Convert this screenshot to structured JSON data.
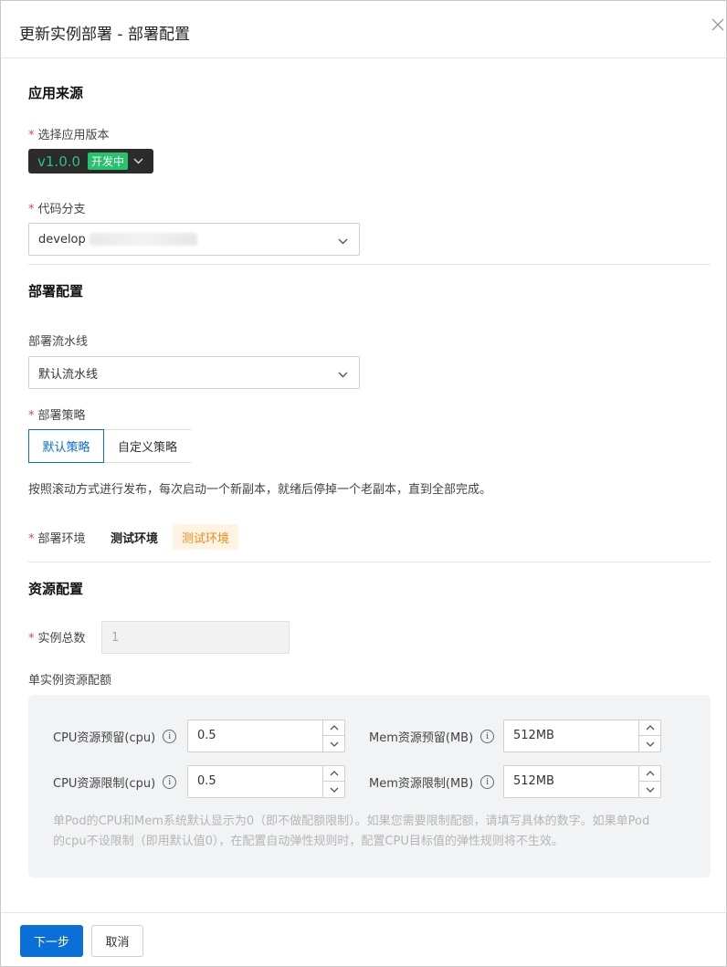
{
  "dialog": {
    "title": "更新实例部署 - 部署配置",
    "close_icon": "close-icon"
  },
  "app_source": {
    "section_title": "应用来源",
    "version_label": "选择应用版本",
    "version_value": "v1.0.0",
    "version_tag": "开发中",
    "branch_label": "代码分支",
    "branch_value": "develop"
  },
  "deploy": {
    "section_title": "部署配置",
    "pipeline_label": "部署流水线",
    "pipeline_value": "默认流水线",
    "strategy_label": "部署策略",
    "strategy_options": [
      "默认策略",
      "自定义策略"
    ],
    "strategy_selected": "默认策略",
    "strategy_desc": "按照滚动方式进行发布，每次启动一个新副本，就绪后停掉一个老副本，直到全部完成。",
    "env_label": "部署环境",
    "env_name": "测试环境",
    "env_badge": "测试环境"
  },
  "resources": {
    "section_title": "资源配置",
    "instances_label": "实例总数",
    "instances_value": "1",
    "per_instance_label": "单实例资源配额",
    "cpu_request_label": "CPU资源预留(cpu)",
    "cpu_request_value": "0.5",
    "mem_request_label": "Mem资源预留(MB)",
    "mem_request_value": "512MB",
    "cpu_limit_label": "CPU资源限制(cpu)",
    "cpu_limit_value": "0.5",
    "mem_limit_label": "Mem资源限制(MB)",
    "mem_limit_value": "512MB",
    "info_glyph": "i",
    "hint_line1": "单Pod的CPU和Mem系统默认显示为0（即不做配额限制）。如果您需要限制配额，请填写具体的数字。如果单Pod",
    "hint_line2": "的cpu不设限制（即用默认值0），在配置自动弹性规则时，配置CPU目标值的弹性规则将不生效。"
  },
  "footer": {
    "next_label": "下一步",
    "cancel_label": "取消"
  },
  "colors": {
    "primary": "#0a6fd6",
    "required": "#e54545",
    "version_green": "#2ec27e",
    "env_orange": "#f08c1a"
  },
  "required_mark": "*"
}
